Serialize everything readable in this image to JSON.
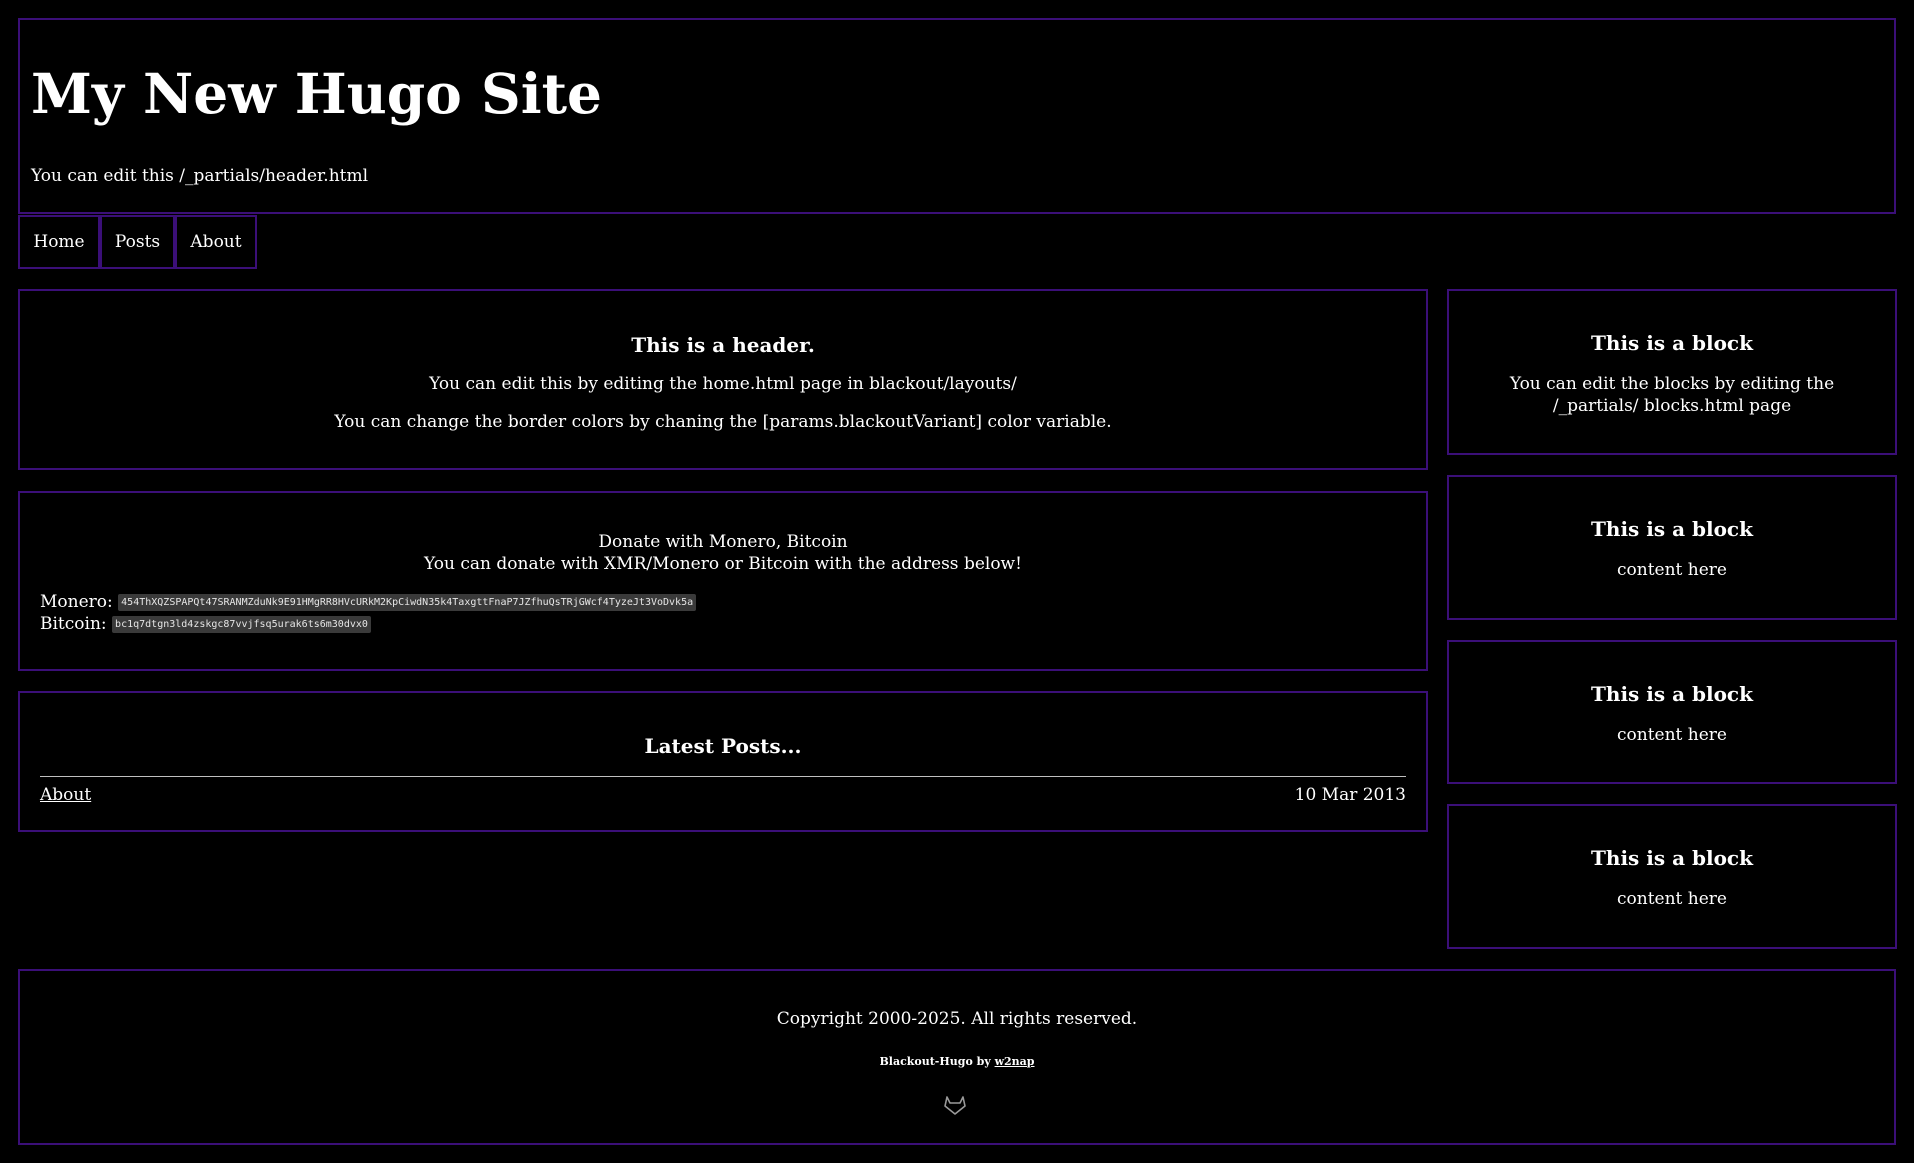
{
  "header": {
    "title": "My New Hugo Site",
    "subtitle": "You can edit this /_partials/header.html"
  },
  "nav": {
    "items": [
      {
        "label": "Home"
      },
      {
        "label": "Posts"
      },
      {
        "label": "About"
      }
    ]
  },
  "intro": {
    "title": "This is a header.",
    "line1": "You can edit this by editing the home.html page in blackout/layouts/",
    "line2": "You can change the border colors by chaning the [params.blackoutVariant] color variable."
  },
  "donate": {
    "title": "Donate with Monero, Bitcoin",
    "description": "You can donate with XMR/Monero or Bitcoin with the address below!",
    "monero_label": "Monero:",
    "monero_address": "454ThXQZSPAPQt47SRANMZduNk9E91HMgRR8HVcURkM2KpCiwdN35k4TaxgttFnaP7JZfhuQsTRjGWcf4TyzeJt3VoDvk5a",
    "bitcoin_label": "Bitcoin:",
    "bitcoin_address": "bc1q7dtgn3ld4zskgc87vvjfsq5urak6ts6m30dvx0"
  },
  "posts": {
    "title": "Latest Posts...",
    "items": [
      {
        "title": "About",
        "date": "10 Mar 2013"
      }
    ]
  },
  "sidebar": {
    "blocks": [
      {
        "title": "This is a block",
        "body": "You can edit the blocks by editing the /_partials/ blocks.html page"
      },
      {
        "title": "This is a block",
        "body": "content here"
      },
      {
        "title": "This is a block",
        "body": "content here"
      },
      {
        "title": "This is a block",
        "body": "content here"
      }
    ]
  },
  "footer": {
    "copyright": "Copyright 2000-2025. All rights reserved.",
    "credit_prefix": "Blackout-Hugo by",
    "credit_link": "w2nap",
    "icon": "gitlab-icon"
  },
  "colors": {
    "background": "#000000",
    "border": "#3b0f78",
    "text": "#ffffff"
  }
}
